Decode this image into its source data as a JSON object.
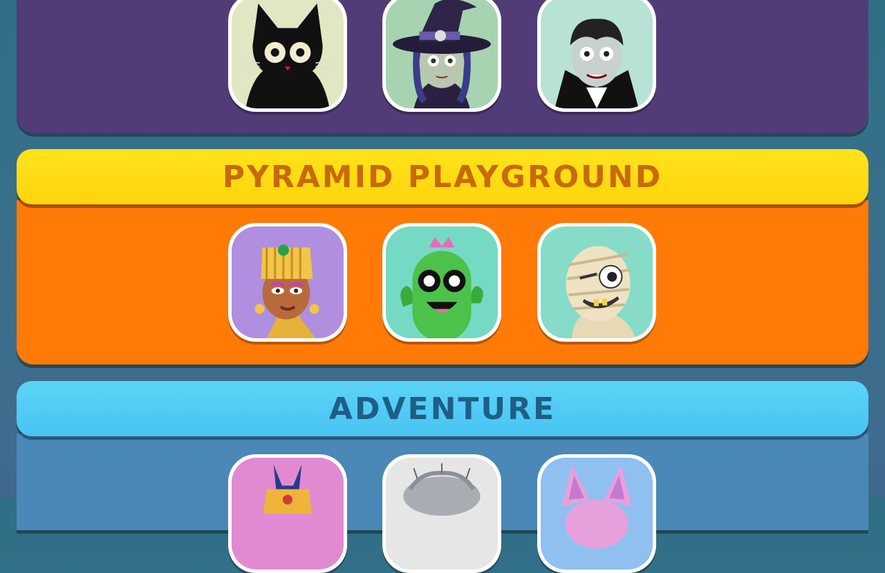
{
  "sections": [
    {
      "id": "halloween",
      "title": "",
      "color": "#523c78",
      "characters": [
        {
          "name": "black-cat",
          "icon": "black-cat-icon",
          "bg": "#e0e7c2"
        },
        {
          "name": "witch",
          "icon": "witch-icon",
          "bg": "#a8d3b0"
        },
        {
          "name": "vampire",
          "icon": "vampire-icon",
          "bg": "#b8e2d6"
        }
      ]
    },
    {
      "id": "pyramid",
      "title": "PYRAMID PLAYGROUND",
      "color": "#ff7a07",
      "banner_color": "#ffdc14",
      "characters": [
        {
          "name": "pharaoh-queen",
          "icon": "pharaoh-queen-icon",
          "bg": "#b08ee0"
        },
        {
          "name": "cactus",
          "icon": "cactus-icon",
          "bg": "#76d9c4"
        },
        {
          "name": "mummy",
          "icon": "mummy-icon",
          "bg": "#86dcc8"
        }
      ]
    },
    {
      "id": "adventure",
      "title": "ADVENTURE",
      "color": "#4a88b7",
      "banner_color": "#52ccf5",
      "characters": [
        {
          "name": "anubis",
          "icon": "anubis-icon",
          "bg": "#e28ad1"
        },
        {
          "name": "yeti",
          "icon": "yeti-icon",
          "bg": "#e6e6e6"
        },
        {
          "name": "bunny",
          "icon": "bunny-icon",
          "bg": "#8fc0f0"
        }
      ]
    }
  ]
}
